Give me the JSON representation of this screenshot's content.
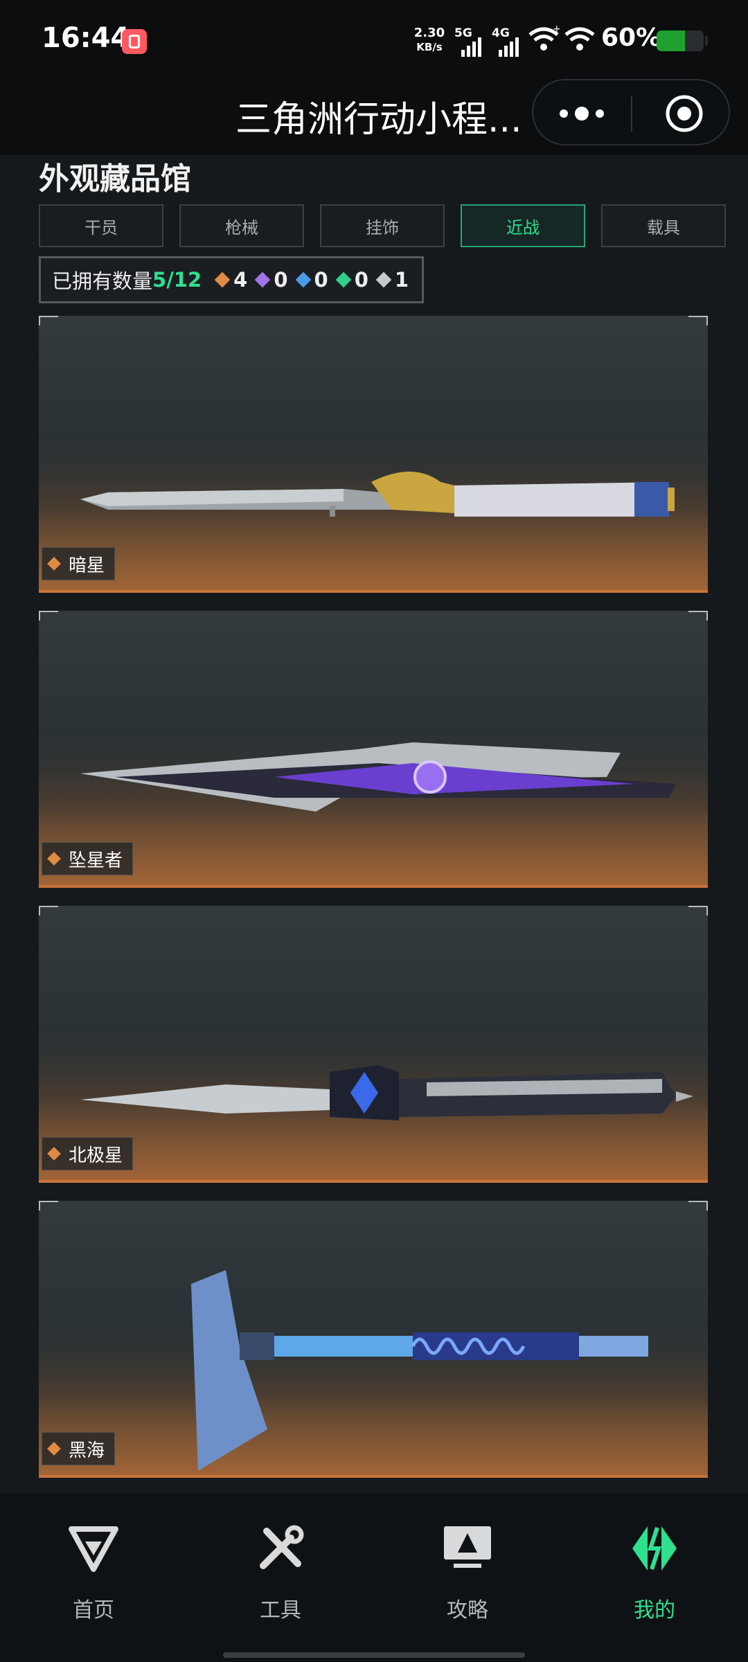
{
  "status_bar": {
    "time": "16:44",
    "net_speed_value": "2.30",
    "net_speed_unit": "KB/s",
    "sim1_label": "5G",
    "sim2_label": "4G",
    "battery_text": "60%",
    "battery_level": 0.6,
    "battery_color": "#1fa12f"
  },
  "nav": {
    "title": "三角洲行动小程...",
    "more_icon": "more-dots-icon",
    "close_icon": "target-circle-icon"
  },
  "page": {
    "title": "外观藏品馆",
    "tabs": [
      {
        "label": "干员",
        "active": false
      },
      {
        "label": "枪械",
        "active": false
      },
      {
        "label": "挂饰",
        "active": false
      },
      {
        "label": "近战",
        "active": true
      },
      {
        "label": "载具",
        "active": false
      }
    ],
    "owned": {
      "label": "已拥有数量",
      "count": "5/12",
      "rarities": [
        {
          "value": "4",
          "color": "#e08a43"
        },
        {
          "value": "0",
          "color": "#a074e8"
        },
        {
          "value": "0",
          "color": "#4a9be8"
        },
        {
          "value": "0",
          "color": "#2fd08a"
        },
        {
          "value": "1",
          "color": "#c9c9c9"
        }
      ]
    },
    "cards": [
      {
        "name": "暗星",
        "rarity_color": "#e08a43"
      },
      {
        "name": "坠星者",
        "rarity_color": "#e08a43"
      },
      {
        "name": "北极星",
        "rarity_color": "#e08a43"
      },
      {
        "name": "黑海",
        "rarity_color": "#e08a43"
      }
    ]
  },
  "bottom_nav": {
    "items": [
      {
        "label": "首页",
        "icon": "home-logo-icon",
        "active": false
      },
      {
        "label": "工具",
        "icon": "tools-icon",
        "active": false
      },
      {
        "label": "攻略",
        "icon": "guide-monitor-icon",
        "active": false
      },
      {
        "label": "我的",
        "icon": "profile-logo-icon",
        "active": true
      }
    ],
    "accent": "#2fe08f"
  }
}
